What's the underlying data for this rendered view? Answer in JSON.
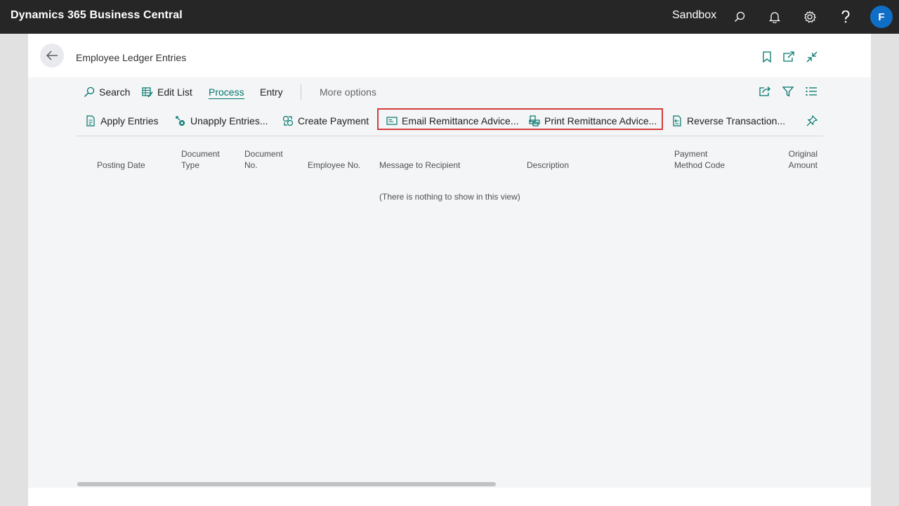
{
  "topbar": {
    "app_title": "Dynamics 365 Business Central",
    "environment": "Sandbox",
    "avatar_initial": "F"
  },
  "page": {
    "title": "Employee Ledger Entries"
  },
  "actionbar": {
    "search": "Search",
    "edit_list": "Edit List",
    "process": "Process",
    "entry": "Entry",
    "more_options": "More options"
  },
  "process_actions": {
    "apply_entries": "Apply Entries",
    "unapply_entries": "Unapply Entries...",
    "create_payment": "Create Payment",
    "email_remittance": "Email Remittance Advice...",
    "print_remittance": "Print Remittance Advice...",
    "reverse_transaction": "Reverse Transaction..."
  },
  "columns": [
    {
      "line1": "Posting Date",
      "line2": ""
    },
    {
      "line1": "Document",
      "line2": "Type"
    },
    {
      "line1": "Document",
      "line2": "No."
    },
    {
      "line1": "Employee No.",
      "line2": ""
    },
    {
      "line1": "Message to Recipient",
      "line2": ""
    },
    {
      "line1": "Description",
      "line2": ""
    },
    {
      "line1": "Payment",
      "line2": "Method Code"
    },
    {
      "line1": "Original",
      "line2": "Amount"
    }
  ],
  "empty_message": "(There is nothing to show in this view)",
  "colors": {
    "accent": "#00766b",
    "highlight": "#d43d3d",
    "topbar": "#262626",
    "avatar": "#0f6fc6"
  }
}
